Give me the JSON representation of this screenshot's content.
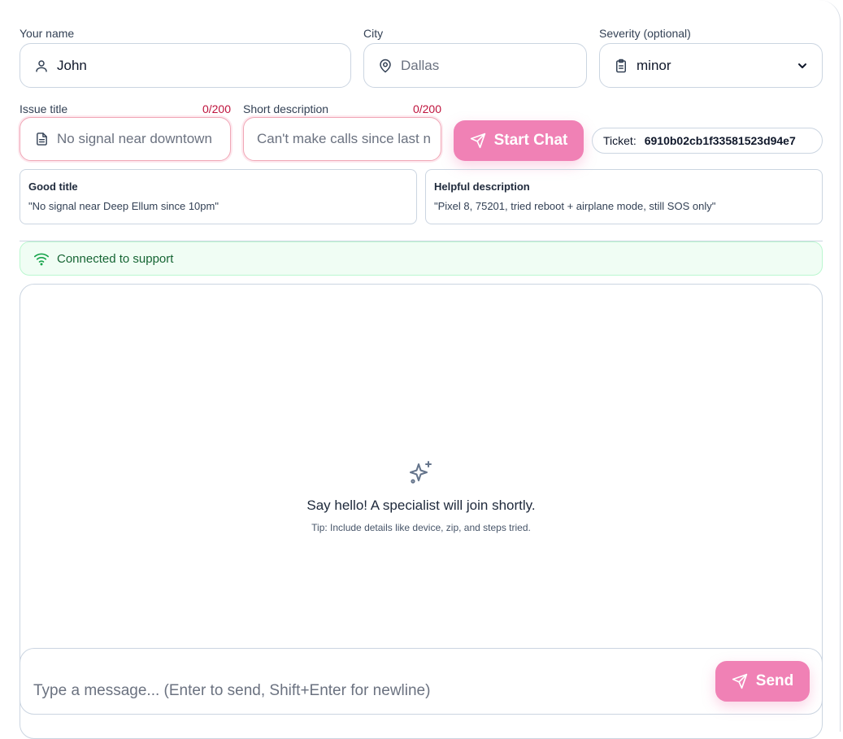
{
  "form": {
    "name": {
      "label": "Your name",
      "value": "John"
    },
    "city": {
      "label": "City",
      "placeholder": "Dallas"
    },
    "severity": {
      "label": "Severity (optional)",
      "value": "minor"
    },
    "issue_title": {
      "label": "Issue title",
      "counter": "0/200",
      "placeholder": "No signal near downtown"
    },
    "short_description": {
      "label": "Short description",
      "counter": "0/200",
      "placeholder": "Can't make calls since last n"
    }
  },
  "start_chat_label": "Start Chat",
  "ticket": {
    "label": "Ticket:",
    "value": "6910b02cb1f33581523d94e7"
  },
  "hints": [
    {
      "title": "Good title",
      "body": "\"No signal near Deep Ellum since 10pm\""
    },
    {
      "title": "Helpful description",
      "body": "\"Pixel 8, 75201, tried reboot + airplane mode, still SOS only\""
    }
  ],
  "status": {
    "text": "Connected to support",
    "color": "#166534"
  },
  "chat": {
    "empty_title": "Say hello! A specialist will join shortly.",
    "empty_tip": "Tip: Include details like device, zip, and steps tried."
  },
  "composer": {
    "placeholder": "Type a message... (Enter to send, Shift+Enter for newline)",
    "send_label": "Send"
  },
  "colors": {
    "accent": "#f081b5",
    "error": "#be123c",
    "success_bg": "#f0fdf4"
  },
  "icons": [
    "user-icon",
    "map-pin-icon",
    "clipboard-icon",
    "chevron-down-icon",
    "document-icon",
    "send-icon",
    "wifi-icon",
    "sparkles-icon"
  ]
}
